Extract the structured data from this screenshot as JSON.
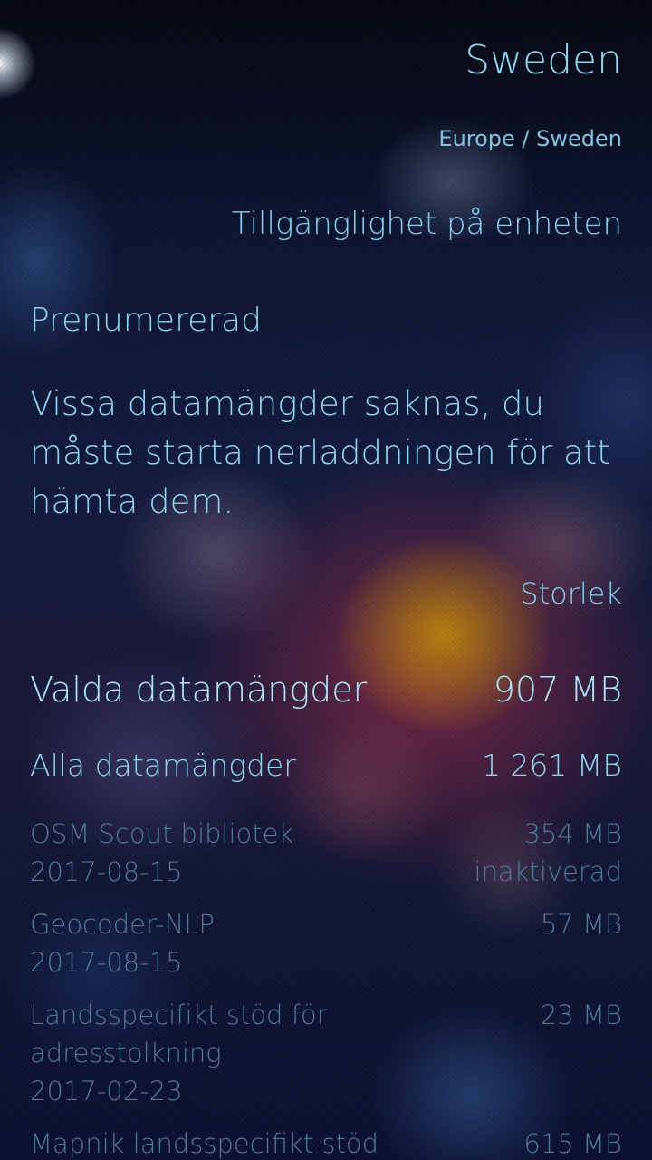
{
  "header": {
    "title": "Sweden",
    "breadcrumb": "Europe / Sweden"
  },
  "availability": {
    "section_title": "Tillgänglighet på enheten",
    "status": "Prenumererad",
    "message": "Vissa datamängder saknas, du måste starta nerladdningen för att hämta dem."
  },
  "sizes": {
    "column_header": "Storlek",
    "selected": {
      "label": "Valda datamängder",
      "size": "907 MB"
    },
    "all": {
      "label": "Alla datamängder",
      "size": "1 261 MB"
    },
    "datasets": [
      {
        "name": "OSM Scout bibliotek",
        "date": "2017-08-15",
        "size": "354 MB",
        "state": "inaktiverad"
      },
      {
        "name": "Geocoder-NLP",
        "date": "2017-08-15",
        "size": "57 MB"
      },
      {
        "name_line1": "Landsspecifikt stöd för",
        "name_line2": "adresstolkning",
        "date": "2017-02-23",
        "size": "23 MB"
      },
      {
        "name": "Mapnik landsspecifikt stöd",
        "size": "615 MB"
      }
    ]
  },
  "colors": {
    "highlight": "#8ad7f0",
    "secondary": "#4f7a98"
  }
}
